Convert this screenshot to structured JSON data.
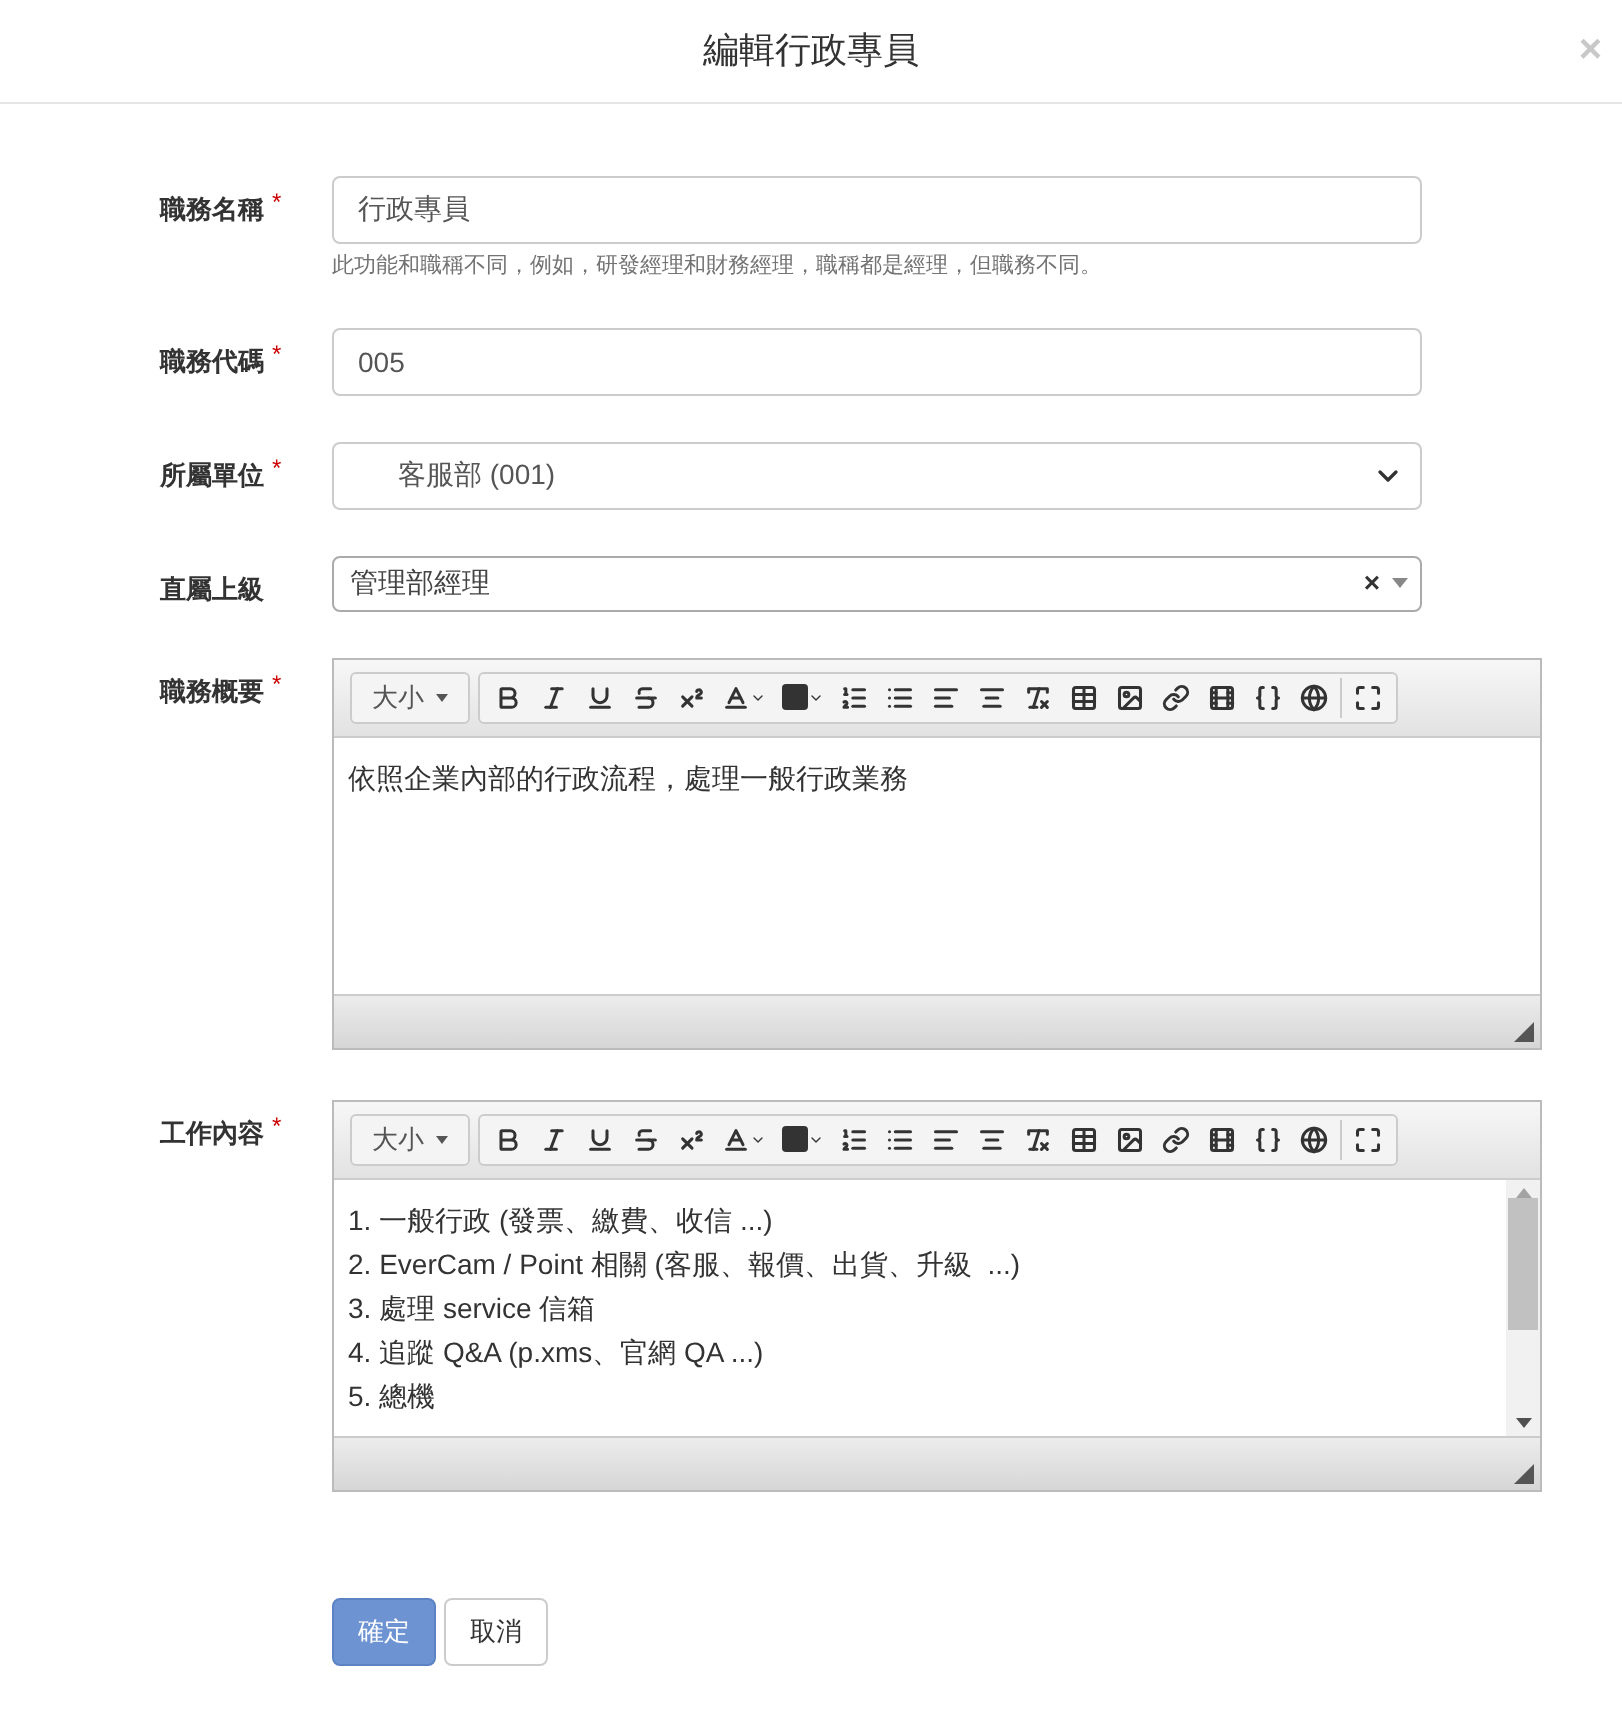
{
  "dialog": {
    "title": "編輯行政專員",
    "close": "×"
  },
  "fields": [
    {
      "kind": "text",
      "label": "職務名稱",
      "required_mark": "*",
      "value": "行政專員",
      "help": "此功能和職稱不同，例如，研發經理和財務經理，職稱都是經理，但職務不同。"
    },
    {
      "kind": "text",
      "label": "職務代碼",
      "required_mark": "*",
      "value": "005"
    },
    {
      "kind": "select",
      "label": "所屬單位",
      "required_mark": "*",
      "value": "客服部 (001)"
    },
    {
      "kind": "combo",
      "label": "直屬上級",
      "value": "管理部經理",
      "clear": "×"
    },
    {
      "kind": "editor",
      "label": "職務概要",
      "required_mark": "*",
      "font_size": "大小",
      "lines": [
        "依照企業內部的行政流程，處理一般行政業務"
      ]
    },
    {
      "kind": "editor",
      "label": "工作內容",
      "required_mark": "*",
      "font_size": "大小",
      "scroll": true,
      "lines": [
        "1. 一般行政 (發票、繳費、收信 ...)",
        "2. EverCam / Point 相關 (客服、報價、出貨、升級  ...)",
        "3. 處理 service 信箱",
        "4. 追蹤 Q&A (p.xms、官網 QA ...)",
        "5. 總機"
      ]
    }
  ],
  "buttons": [
    {
      "label": "確定",
      "kind": "primary"
    },
    {
      "label": "取消",
      "kind": "default"
    }
  ]
}
